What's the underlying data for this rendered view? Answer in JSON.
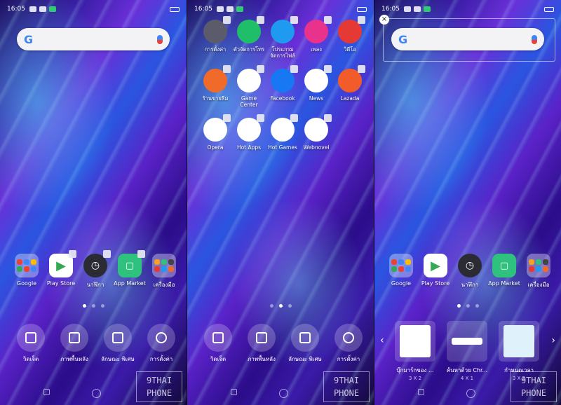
{
  "screens": [
    {
      "status": {
        "time": "16:05"
      },
      "dock": [
        {
          "label": "Google"
        },
        {
          "label": "Play Store"
        },
        {
          "label": "นาฬิกา"
        },
        {
          "label": "App Market"
        },
        {
          "label": "เครื่องมือ"
        }
      ],
      "editbar": [
        {
          "label": "วิดเจ็ต"
        },
        {
          "label": "ภาพพื้นหลัง"
        },
        {
          "label": "ลักษณะ พิเศษ"
        },
        {
          "label": "การตั้งค่า"
        }
      ]
    },
    {
      "status": {
        "time": "16:05"
      },
      "apps": [
        {
          "label": "การตั้งค่า",
          "color": "#5b5b6b"
        },
        {
          "label": "ตัวจัดการโทร",
          "color": "#1fbf6a"
        },
        {
          "label": "โปรแกรมจัดการไฟล์",
          "color": "#1e9af0"
        },
        {
          "label": "เพลง",
          "color": "#e8328c"
        },
        {
          "label": "วิดีโอ",
          "color": "#e53935"
        },
        {
          "label": "ร้านขายธีม",
          "color": "#f06a2a"
        },
        {
          "label": "Game Center",
          "color": "#ffffff"
        },
        {
          "label": "Facebook",
          "color": "#1877f2"
        },
        {
          "label": "News",
          "color": "#ffffff"
        },
        {
          "label": "Lazada",
          "color": "#f25c2a"
        },
        {
          "label": "Opera",
          "color": "#ffffff"
        },
        {
          "label": "Hot Apps",
          "color": "#ffffff"
        },
        {
          "label": "Hot Games",
          "color": "#ffffff"
        },
        {
          "label": "Webnovel",
          "color": "#ffffff"
        }
      ],
      "editbar": [
        {
          "label": "วิดเจ็ต"
        },
        {
          "label": "ภาพพื้นหลัง"
        },
        {
          "label": "ลักษณะ พิเศษ"
        },
        {
          "label": "การตั้งค่า"
        }
      ]
    },
    {
      "status": {
        "time": "16:05"
      },
      "dock": [
        {
          "label": "Google"
        },
        {
          "label": "Play Store"
        },
        {
          "label": "นาฬิกา"
        },
        {
          "label": "App Market"
        },
        {
          "label": "เครื่องมือ"
        }
      ],
      "widgets": [
        {
          "label": "บุ๊กมาร์กของ ...",
          "size": "3 X 2"
        },
        {
          "label": "ค้นหาด้วย Chr...",
          "size": "4 X 1"
        },
        {
          "label": "กำหนดเวลา",
          "size": "3 X 2"
        }
      ],
      "close_symbol": "×",
      "arrow_left": "‹",
      "arrow_right": "›"
    }
  ],
  "google_letter": "G",
  "watermark": {
    "line1": "9THAI",
    "line2": "PHONE"
  }
}
